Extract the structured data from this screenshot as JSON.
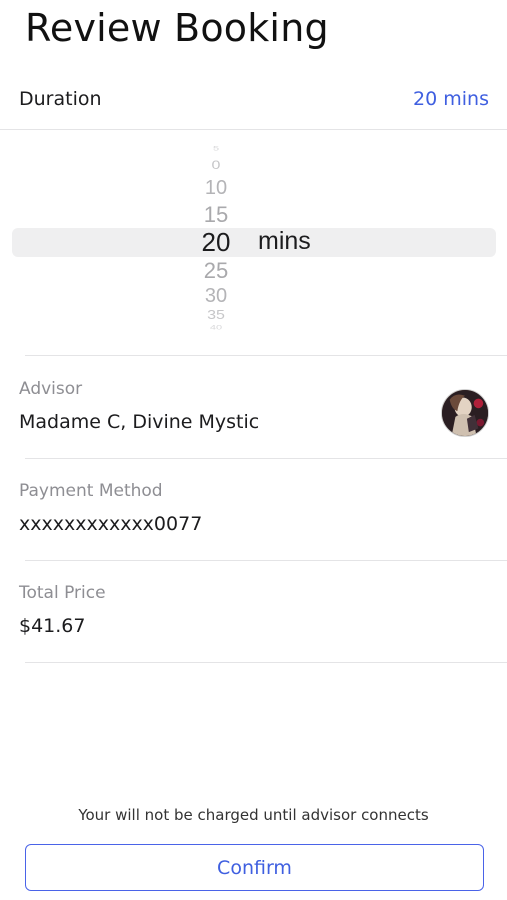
{
  "header": {
    "title": "Review Booking"
  },
  "duration": {
    "label": "Duration",
    "value": "20 mins",
    "picker": {
      "items": [
        "5",
        "0",
        "10",
        "15",
        "20",
        "25",
        "30",
        "35",
        "40"
      ],
      "selected": "20",
      "unit": "mins"
    }
  },
  "advisor": {
    "label": "Advisor",
    "name": "Madame C, Divine Mystic",
    "avatar_icon": "advisor-avatar"
  },
  "payment": {
    "label": "Payment Method",
    "value": "xxxxxxxxxxxx0077"
  },
  "price": {
    "label": "Total Price",
    "value": "$41.67"
  },
  "footer": {
    "notice": "Your will not be charged until advisor connects",
    "confirm_label": "Confirm"
  },
  "colors": {
    "accent": "#3f5fe0",
    "divider": "#e4e4e6",
    "secondary_text": "#8e8e93"
  }
}
